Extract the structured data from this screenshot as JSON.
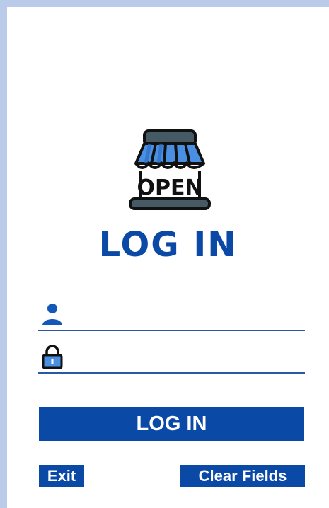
{
  "logo": {
    "sign_text": "OPEN",
    "icon": "open-shop-icon"
  },
  "title": "LOG IN",
  "fields": {
    "username": {
      "icon": "user-icon",
      "value": "",
      "placeholder": ""
    },
    "password": {
      "icon": "lock-icon",
      "value": "",
      "placeholder": ""
    }
  },
  "buttons": {
    "login_label": "LOG IN",
    "exit_label": "Exit",
    "clear_label": "Clear Fields"
  },
  "colors": {
    "accent": "#0b49a6",
    "window_border": "#b9cbe9",
    "awning_light": "#4a90e2",
    "awning_dark": "#455a64"
  }
}
